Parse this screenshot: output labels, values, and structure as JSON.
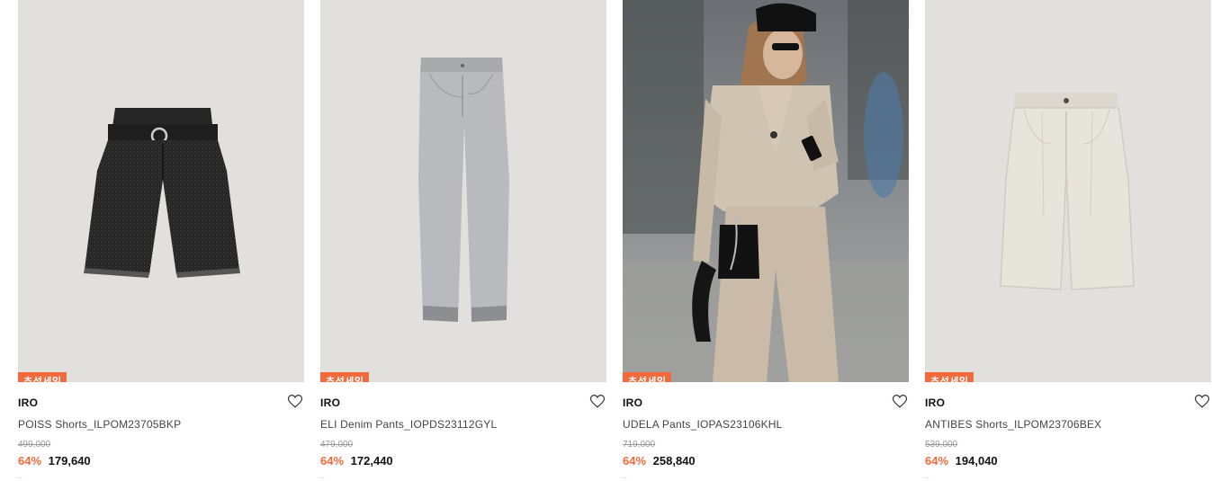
{
  "accent_color": "#f16a3c",
  "products": [
    {
      "badge": "추석세일",
      "brand": "IRO",
      "name": "POISS Shorts_ILPOM23705BKP",
      "original_price": "499,000",
      "discount": "64%",
      "price": "179,640",
      "image_icon": "black-tweed-shorts-image",
      "more": ".."
    },
    {
      "badge": "추석세일",
      "brand": "IRO",
      "name": "ELI Denim Pants_IOPDS23112GYL",
      "original_price": "479,000",
      "discount": "64%",
      "price": "172,440",
      "image_icon": "grey-denim-pants-image",
      "more": ".."
    },
    {
      "badge": "추석세일",
      "brand": "IRO",
      "name": "UDELA Pants_IOPAS23106KHL",
      "original_price": "719,000",
      "discount": "64%",
      "price": "258,840",
      "image_icon": "model-beige-suit-image",
      "more": ".."
    },
    {
      "badge": "추석세일",
      "brand": "IRO",
      "name": "ANTIBES Shorts_ILPOM23706BEX",
      "original_price": "539,000",
      "discount": "64%",
      "price": "194,040",
      "image_icon": "linen-shorts-image",
      "more": ".."
    }
  ]
}
